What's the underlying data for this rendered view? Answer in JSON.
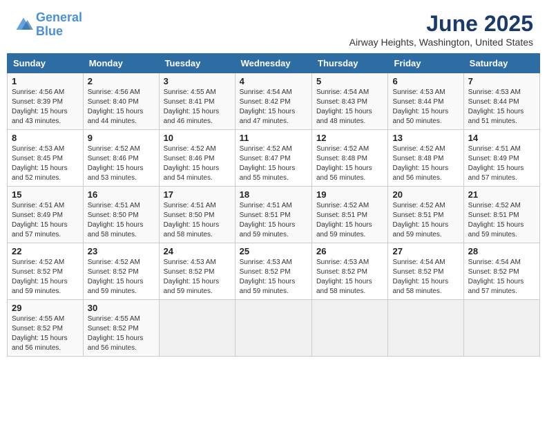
{
  "header": {
    "logo_line1": "General",
    "logo_line2": "Blue",
    "main_title": "June 2025",
    "subtitle": "Airway Heights, Washington, United States"
  },
  "calendar": {
    "days_of_week": [
      "Sunday",
      "Monday",
      "Tuesday",
      "Wednesday",
      "Thursday",
      "Friday",
      "Saturday"
    ],
    "weeks": [
      [
        {
          "day": "1",
          "sunrise": "4:56 AM",
          "sunset": "8:39 PM",
          "daylight": "15 hours and 43 minutes."
        },
        {
          "day": "2",
          "sunrise": "4:56 AM",
          "sunset": "8:40 PM",
          "daylight": "15 hours and 44 minutes."
        },
        {
          "day": "3",
          "sunrise": "4:55 AM",
          "sunset": "8:41 PM",
          "daylight": "15 hours and 46 minutes."
        },
        {
          "day": "4",
          "sunrise": "4:54 AM",
          "sunset": "8:42 PM",
          "daylight": "15 hours and 47 minutes."
        },
        {
          "day": "5",
          "sunrise": "4:54 AM",
          "sunset": "8:43 PM",
          "daylight": "15 hours and 48 minutes."
        },
        {
          "day": "6",
          "sunrise": "4:53 AM",
          "sunset": "8:44 PM",
          "daylight": "15 hours and 50 minutes."
        },
        {
          "day": "7",
          "sunrise": "4:53 AM",
          "sunset": "8:44 PM",
          "daylight": "15 hours and 51 minutes."
        }
      ],
      [
        {
          "day": "8",
          "sunrise": "4:53 AM",
          "sunset": "8:45 PM",
          "daylight": "15 hours and 52 minutes."
        },
        {
          "day": "9",
          "sunrise": "4:52 AM",
          "sunset": "8:46 PM",
          "daylight": "15 hours and 53 minutes."
        },
        {
          "day": "10",
          "sunrise": "4:52 AM",
          "sunset": "8:46 PM",
          "daylight": "15 hours and 54 minutes."
        },
        {
          "day": "11",
          "sunrise": "4:52 AM",
          "sunset": "8:47 PM",
          "daylight": "15 hours and 55 minutes."
        },
        {
          "day": "12",
          "sunrise": "4:52 AM",
          "sunset": "8:48 PM",
          "daylight": "15 hours and 56 minutes."
        },
        {
          "day": "13",
          "sunrise": "4:52 AM",
          "sunset": "8:48 PM",
          "daylight": "15 hours and 56 minutes."
        },
        {
          "day": "14",
          "sunrise": "4:51 AM",
          "sunset": "8:49 PM",
          "daylight": "15 hours and 57 minutes."
        }
      ],
      [
        {
          "day": "15",
          "sunrise": "4:51 AM",
          "sunset": "8:49 PM",
          "daylight": "15 hours and 57 minutes."
        },
        {
          "day": "16",
          "sunrise": "4:51 AM",
          "sunset": "8:50 PM",
          "daylight": "15 hours and 58 minutes."
        },
        {
          "day": "17",
          "sunrise": "4:51 AM",
          "sunset": "8:50 PM",
          "daylight": "15 hours and 58 minutes."
        },
        {
          "day": "18",
          "sunrise": "4:51 AM",
          "sunset": "8:51 PM",
          "daylight": "15 hours and 59 minutes."
        },
        {
          "day": "19",
          "sunrise": "4:52 AM",
          "sunset": "8:51 PM",
          "daylight": "15 hours and 59 minutes."
        },
        {
          "day": "20",
          "sunrise": "4:52 AM",
          "sunset": "8:51 PM",
          "daylight": "15 hours and 59 minutes."
        },
        {
          "day": "21",
          "sunrise": "4:52 AM",
          "sunset": "8:51 PM",
          "daylight": "15 hours and 59 minutes."
        }
      ],
      [
        {
          "day": "22",
          "sunrise": "4:52 AM",
          "sunset": "8:52 PM",
          "daylight": "15 hours and 59 minutes."
        },
        {
          "day": "23",
          "sunrise": "4:52 AM",
          "sunset": "8:52 PM",
          "daylight": "15 hours and 59 minutes."
        },
        {
          "day": "24",
          "sunrise": "4:53 AM",
          "sunset": "8:52 PM",
          "daylight": "15 hours and 59 minutes."
        },
        {
          "day": "25",
          "sunrise": "4:53 AM",
          "sunset": "8:52 PM",
          "daylight": "15 hours and 59 minutes."
        },
        {
          "day": "26",
          "sunrise": "4:53 AM",
          "sunset": "8:52 PM",
          "daylight": "15 hours and 58 minutes."
        },
        {
          "day": "27",
          "sunrise": "4:54 AM",
          "sunset": "8:52 PM",
          "daylight": "15 hours and 58 minutes."
        },
        {
          "day": "28",
          "sunrise": "4:54 AM",
          "sunset": "8:52 PM",
          "daylight": "15 hours and 57 minutes."
        }
      ],
      [
        {
          "day": "29",
          "sunrise": "4:55 AM",
          "sunset": "8:52 PM",
          "daylight": "15 hours and 56 minutes."
        },
        {
          "day": "30",
          "sunrise": "4:55 AM",
          "sunset": "8:52 PM",
          "daylight": "15 hours and 56 minutes."
        },
        {
          "day": "",
          "sunrise": "",
          "sunset": "",
          "daylight": ""
        },
        {
          "day": "",
          "sunrise": "",
          "sunset": "",
          "daylight": ""
        },
        {
          "day": "",
          "sunrise": "",
          "sunset": "",
          "daylight": ""
        },
        {
          "day": "",
          "sunrise": "",
          "sunset": "",
          "daylight": ""
        },
        {
          "day": "",
          "sunrise": "",
          "sunset": "",
          "daylight": ""
        }
      ]
    ]
  }
}
